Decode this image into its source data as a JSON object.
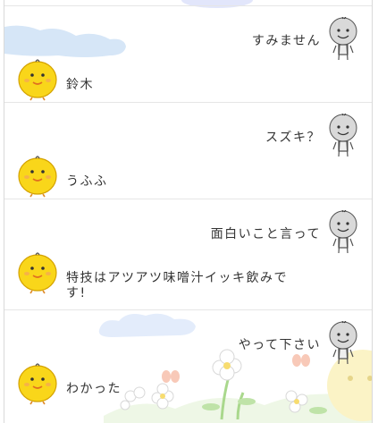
{
  "conversation": {
    "exchanges": [
      {
        "user_message": "すみません",
        "bot_reply": "鈴木"
      },
      {
        "user_message": "スズキ？",
        "bot_reply": "うふふ"
      },
      {
        "user_message": "面白いこと言って",
        "bot_reply": "特技はアツアツ味噌汁イッキ飲みで\nす!"
      },
      {
        "user_message": "やって下さい",
        "bot_reply": "わかった"
      }
    ]
  },
  "colors": {
    "user_avatar": "#d9d9d9",
    "bot_avatar": "#f9d61a",
    "divider": "#e6e6e6",
    "text": "#333333",
    "cloud": "#d6e6f7"
  },
  "icons": {
    "user_avatar": "gray-stick-figure-icon",
    "bot_avatar": "yellow-chick-icon"
  }
}
